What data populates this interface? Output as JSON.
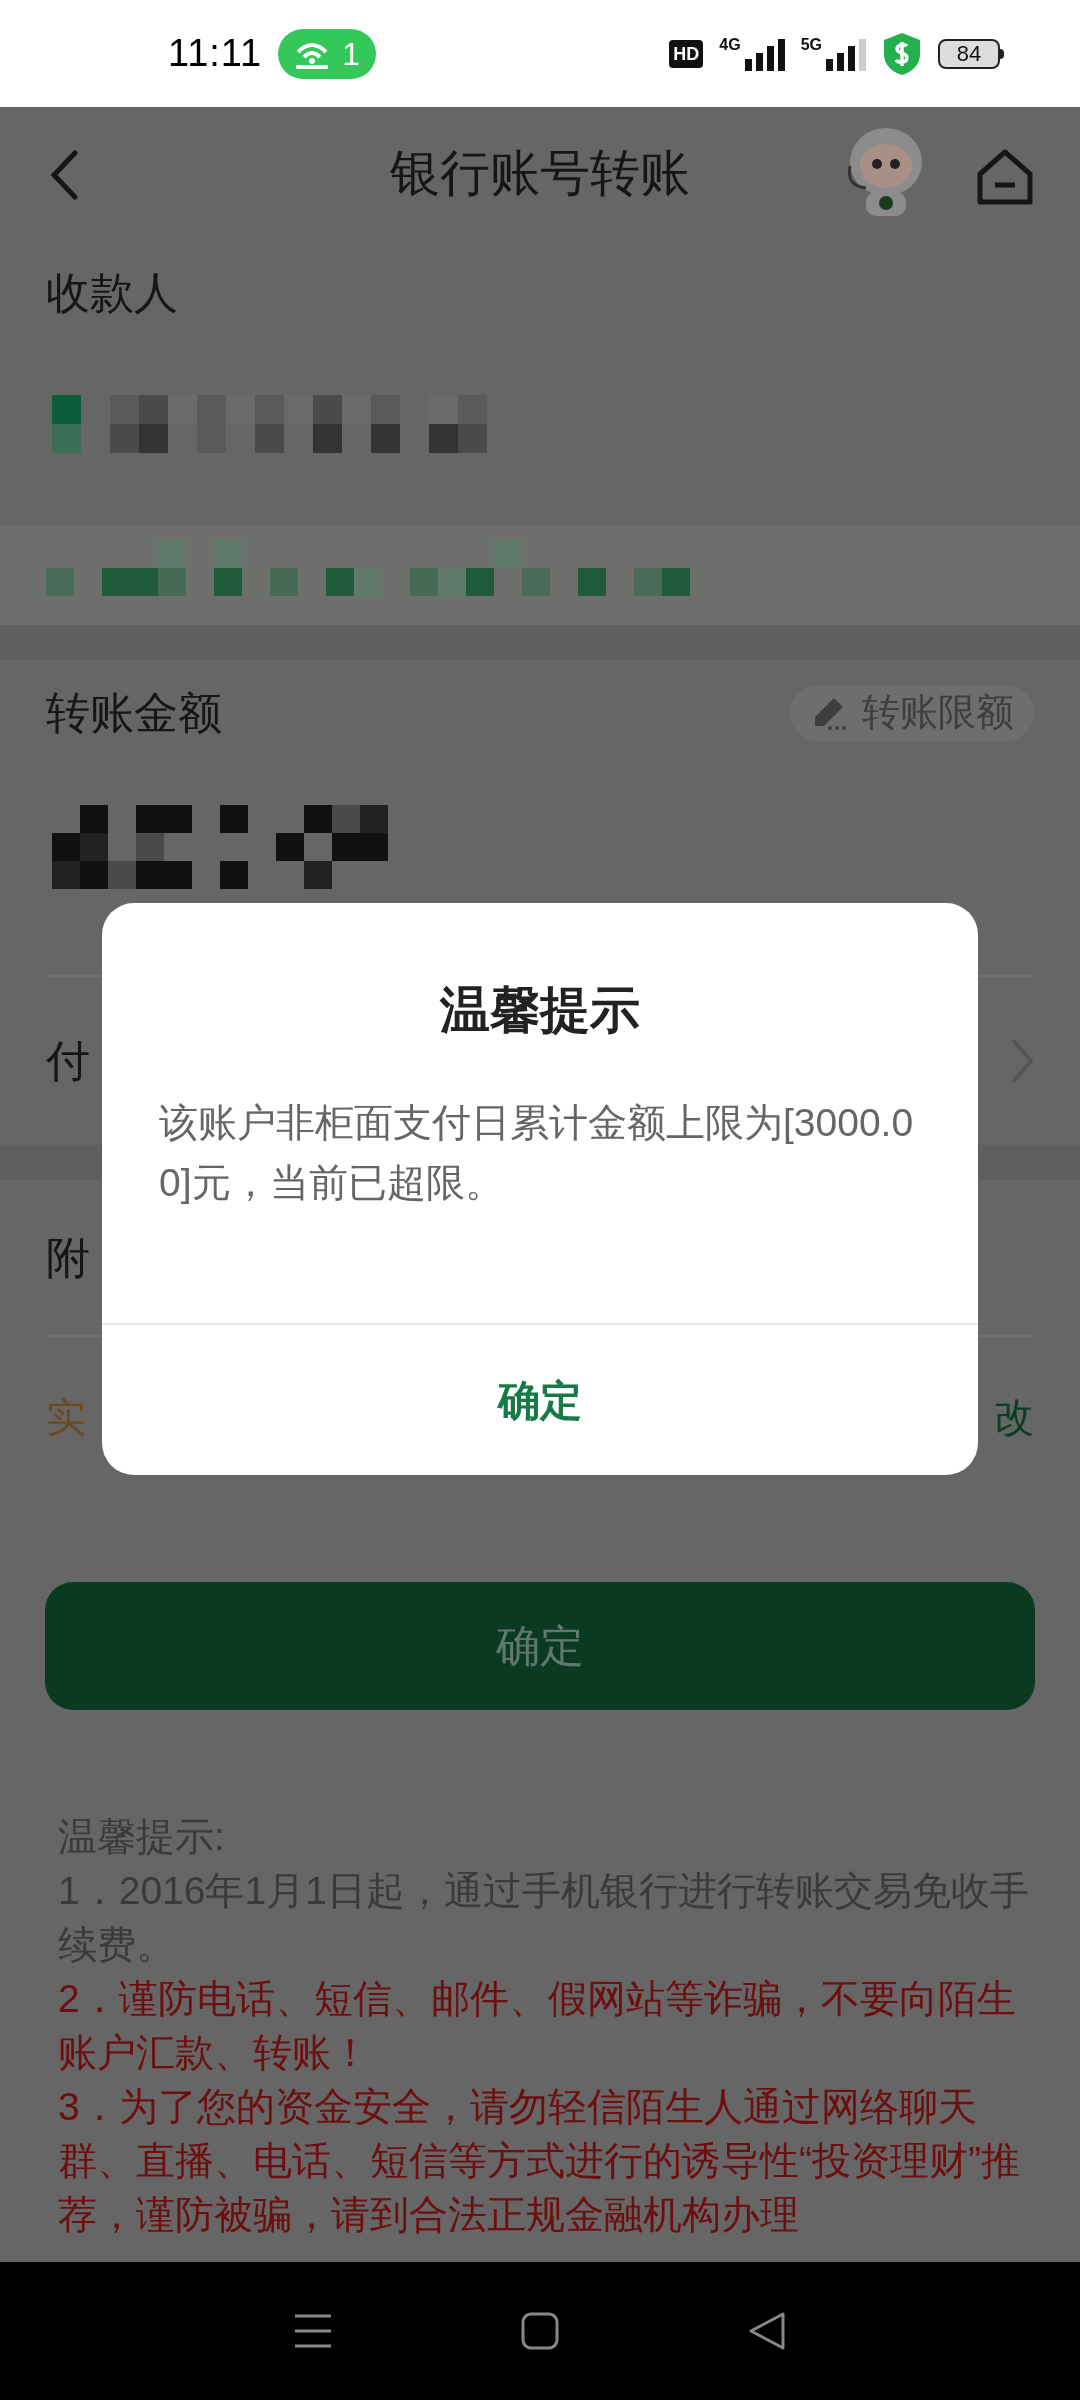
{
  "status_bar": {
    "time": "11:11",
    "hotspot_count": "1",
    "network_badge": "HD",
    "net_4g": "4G",
    "net_5g": "5G",
    "battery": "84"
  },
  "header": {
    "title": "银行账号转账"
  },
  "payee": {
    "label": "收款人"
  },
  "amount": {
    "label": "转账金额",
    "limit_button": "转账限额"
  },
  "rows": [
    {
      "kind": "chevron",
      "label": "付"
    },
    {
      "kind": "plain",
      "label": "附"
    },
    {
      "kind": "action",
      "label": "实",
      "action": "改"
    }
  ],
  "submit_button": "确定",
  "tips": {
    "title": "温馨提示:",
    "items": [
      {
        "text": "1．2016年1月1日起，通过手机银行进行转账交易免收手续费。",
        "warning": false
      },
      {
        "text": "2．谨防电话、短信、邮件、假网站等诈骗，不要向陌生账户汇款、转账！",
        "warning": true
      },
      {
        "text": "3．为了您的资金安全，请勿轻信陌生人通过网络聊天群、直播、电话、短信等方式进行的诱导性“投资理财”推荐，谨防被骗，请到合法正规金融机构办理",
        "warning": true
      }
    ]
  },
  "dialog": {
    "title": "温馨提示",
    "message": "该账户非柜面支付日累计金额上限为[3000.00]元，当前已超限。",
    "button": "确定"
  }
}
